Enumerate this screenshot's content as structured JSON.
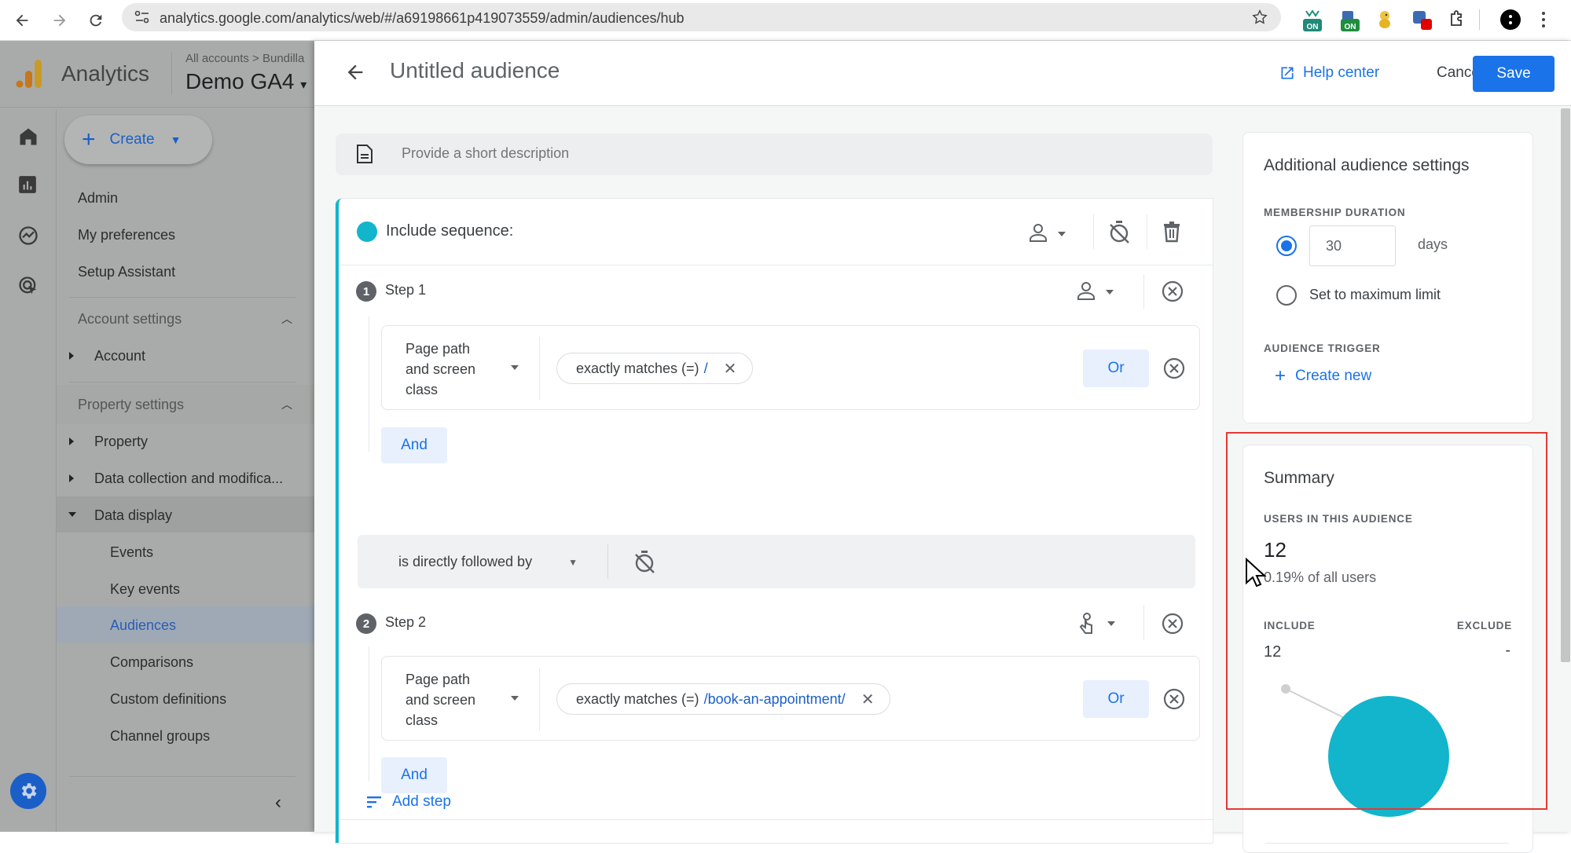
{
  "browser": {
    "url": "analytics.google.com/analytics/web/#/a69198661p419073559/admin/audiences/hub",
    "extensions": [
      {
        "name": "extension-on-1",
        "badge": "ON",
        "color": "#1f8a78"
      },
      {
        "name": "extension-on-2",
        "badge": "ON",
        "color": "#1e8e3e"
      },
      {
        "name": "extension-duck",
        "badge": "",
        "color": "#e6b422"
      },
      {
        "name": "extension-red",
        "badge": "",
        "color": "#e00000"
      }
    ]
  },
  "app": {
    "name": "Analytics",
    "breadcrumb": "All accounts > Bundilla",
    "property": "Demo GA4"
  },
  "sidebar": {
    "create_label": "Create",
    "top_items": [
      "Admin",
      "My preferences",
      "Setup Assistant"
    ],
    "account_settings": {
      "label": "Account settings",
      "items": [
        "Account"
      ]
    },
    "property_settings": {
      "label": "Property settings",
      "items": [
        "Property",
        "Data collection and modifica...",
        "Data display"
      ],
      "data_display_children": [
        "Events",
        "Key events",
        "Audiences",
        "Comparisons",
        "Custom definitions",
        "Channel groups"
      ],
      "active": "Audiences"
    }
  },
  "header": {
    "title": "Untitled audience",
    "help_label": "Help center",
    "cancel_label": "Cancel",
    "save_label": "Save"
  },
  "description": {
    "placeholder": "Provide a short description",
    "value": ""
  },
  "sequence": {
    "label": "Include sequence:",
    "color": "#12b5cb",
    "steps": [
      {
        "number": "1",
        "label": "Step 1",
        "dimension": [
          "Page path",
          "and screen",
          "class"
        ],
        "condition": "exactly matches (=)",
        "value": "/",
        "or_label": "Or",
        "and_label": "And"
      },
      {
        "number": "2",
        "label": "Step 2",
        "dimension": [
          "Page path",
          "and screen",
          "class"
        ],
        "condition": "exactly matches (=)",
        "value": "/book-an-appointment/",
        "or_label": "Or",
        "and_label": "And"
      }
    ],
    "connector": "is directly followed by",
    "add_step_label": "Add step"
  },
  "settings": {
    "title": "Additional audience settings",
    "membership_label": "MEMBERSHIP DURATION",
    "duration_value": "30",
    "duration_unit": "days",
    "max_limit_label": "Set to maximum limit",
    "selected": "duration",
    "trigger_label": "AUDIENCE TRIGGER",
    "create_new_label": "Create new"
  },
  "summary": {
    "title": "Summary",
    "users_label": "USERS IN THIS AUDIENCE",
    "users_value": "12",
    "percent_text": "0.19% of all users",
    "include_label": "INCLUDE",
    "include_value": "12",
    "exclude_label": "EXCLUDE",
    "exclude_value": "-"
  },
  "chart_data": {
    "type": "pie",
    "categories": [
      "Include",
      "Exclude"
    ],
    "values": [
      12,
      0
    ],
    "colors": [
      "#12b5cb",
      "#cccccc"
    ]
  }
}
